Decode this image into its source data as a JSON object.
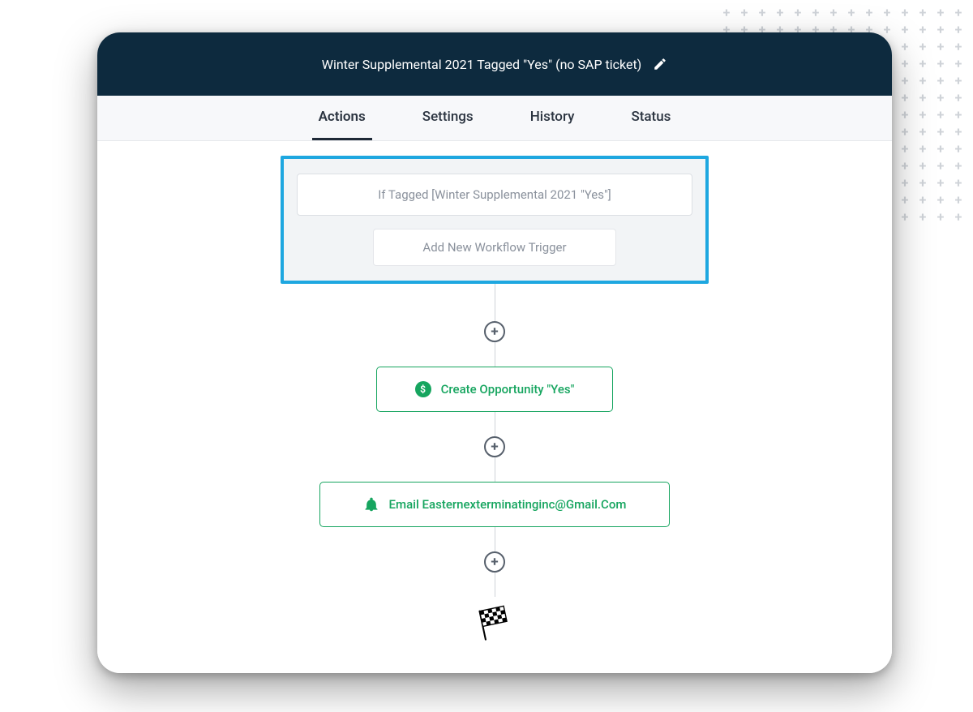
{
  "header": {
    "title": "Winter Supplemental 2021 Tagged \"Yes\" (no SAP ticket)"
  },
  "tabs": {
    "items": [
      "Actions",
      "Settings",
      "History",
      "Status"
    ],
    "activeIndex": 0
  },
  "trigger": {
    "condition": "If Tagged [Winter Supplemental 2021 \"Yes\"]",
    "addLabel": "Add New Workflow Trigger"
  },
  "steps": {
    "createOpportunity": "Create Opportunity \"Yes\"",
    "email": "Email Easternexterminatinginc@Gmail.Com"
  },
  "icons": {
    "dollar": "$",
    "plus": "+"
  }
}
